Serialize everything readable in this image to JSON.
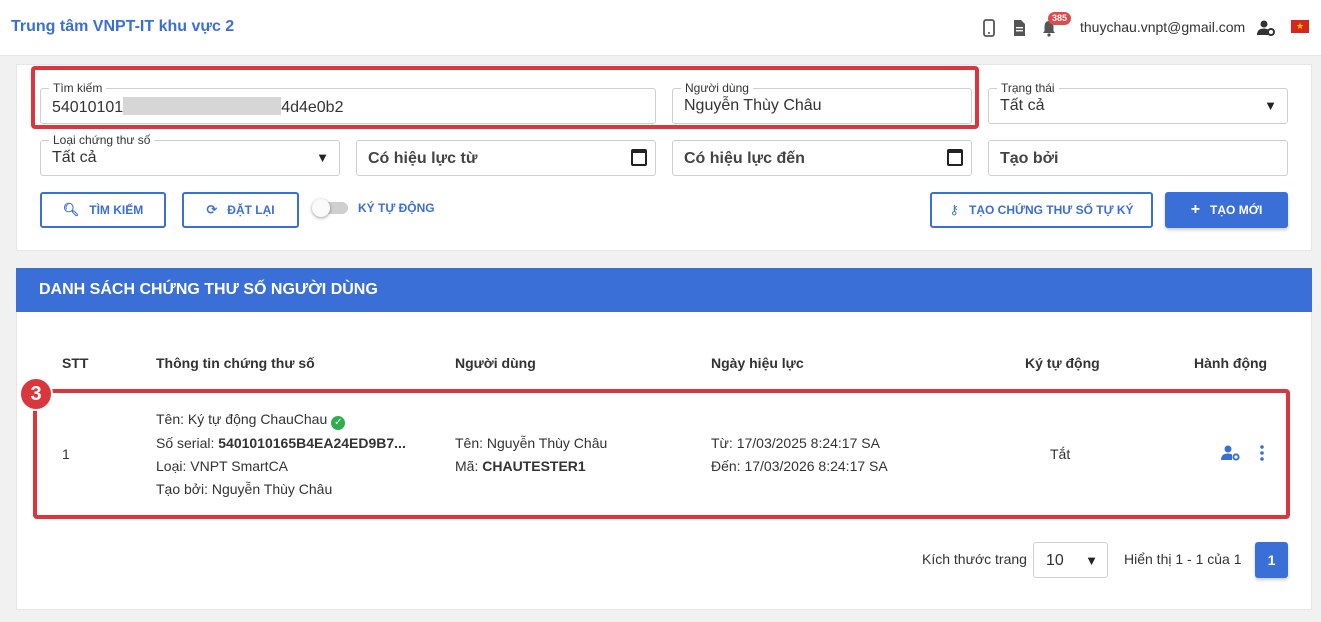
{
  "header": {
    "title": "Trung tâm VNPT-IT khu vực 2",
    "notification_count": "385",
    "user_email": "thuychau.vnpt@gmail.com",
    "icons": [
      "mobile-icon",
      "document-icon",
      "bell-icon",
      "user-settings-icon",
      "vietnam-flag-icon"
    ]
  },
  "filters": {
    "search": {
      "label": "Tìm kiếm",
      "value_prefix": "54010101",
      "value_suffix": "4d4e0b2"
    },
    "user": {
      "label": "Người dùng",
      "value": "Nguyễn Thùy Châu"
    },
    "status": {
      "label": "Trạng thái",
      "value": "Tất cả"
    },
    "cert_type": {
      "label": "Loại chứng thư số",
      "value": "Tất cả"
    },
    "valid_from": {
      "placeholder": "Có hiệu lực từ"
    },
    "valid_to": {
      "placeholder": "Có hiệu lực đến"
    },
    "created_by": {
      "placeholder": "Tạo bởi"
    }
  },
  "actions": {
    "search": "TÌM KIẾM",
    "reset": "ĐẶT LẠI",
    "auto_sign": "KÝ TỰ ĐỘNG",
    "create_self_signed": "TẠO CHỨNG THƯ SỐ TỰ KÝ",
    "create_new": "TẠO MỚI"
  },
  "list": {
    "title": "DANH SÁCH CHỨNG THƯ SỐ NGƯỜI DÙNG",
    "columns": [
      "STT",
      "Thông tin chứng thư số",
      "Người dùng",
      "Ngày hiệu lực",
      "Ký tự động",
      "Hành động"
    ],
    "step_marker": "3",
    "rows": [
      {
        "stt": "1",
        "name_label": "Tên: ",
        "name": "Ký tự động ChauChau",
        "serial_label": "Số serial: ",
        "serial": "5401010165B4EA24ED9B7...",
        "type_label": "Loại: ",
        "type": "VNPT SmartCA",
        "created_label": "Tạo bởi: ",
        "created_by": "Nguyễn Thùy Châu",
        "user_name_label": "Tên: ",
        "user_name": "Nguyễn Thùy Châu",
        "user_code_label": "Mã: ",
        "user_code": "CHAUTESTER1",
        "from_label": "Từ: ",
        "from": "17/03/2025 8:24:17 SA",
        "to_label": "Đến: ",
        "to": "17/03/2026 8:24:17 SA",
        "auto_sign": "Tắt"
      }
    ]
  },
  "pagination": {
    "page_size_label": "Kích thước trang",
    "page_size": "10",
    "info": "Hiển thị 1 - 1 của 1",
    "current_page": "1"
  },
  "colors": {
    "accent": "#3b6fd8",
    "highlight": "#d9363e",
    "success": "#2eae4e"
  }
}
